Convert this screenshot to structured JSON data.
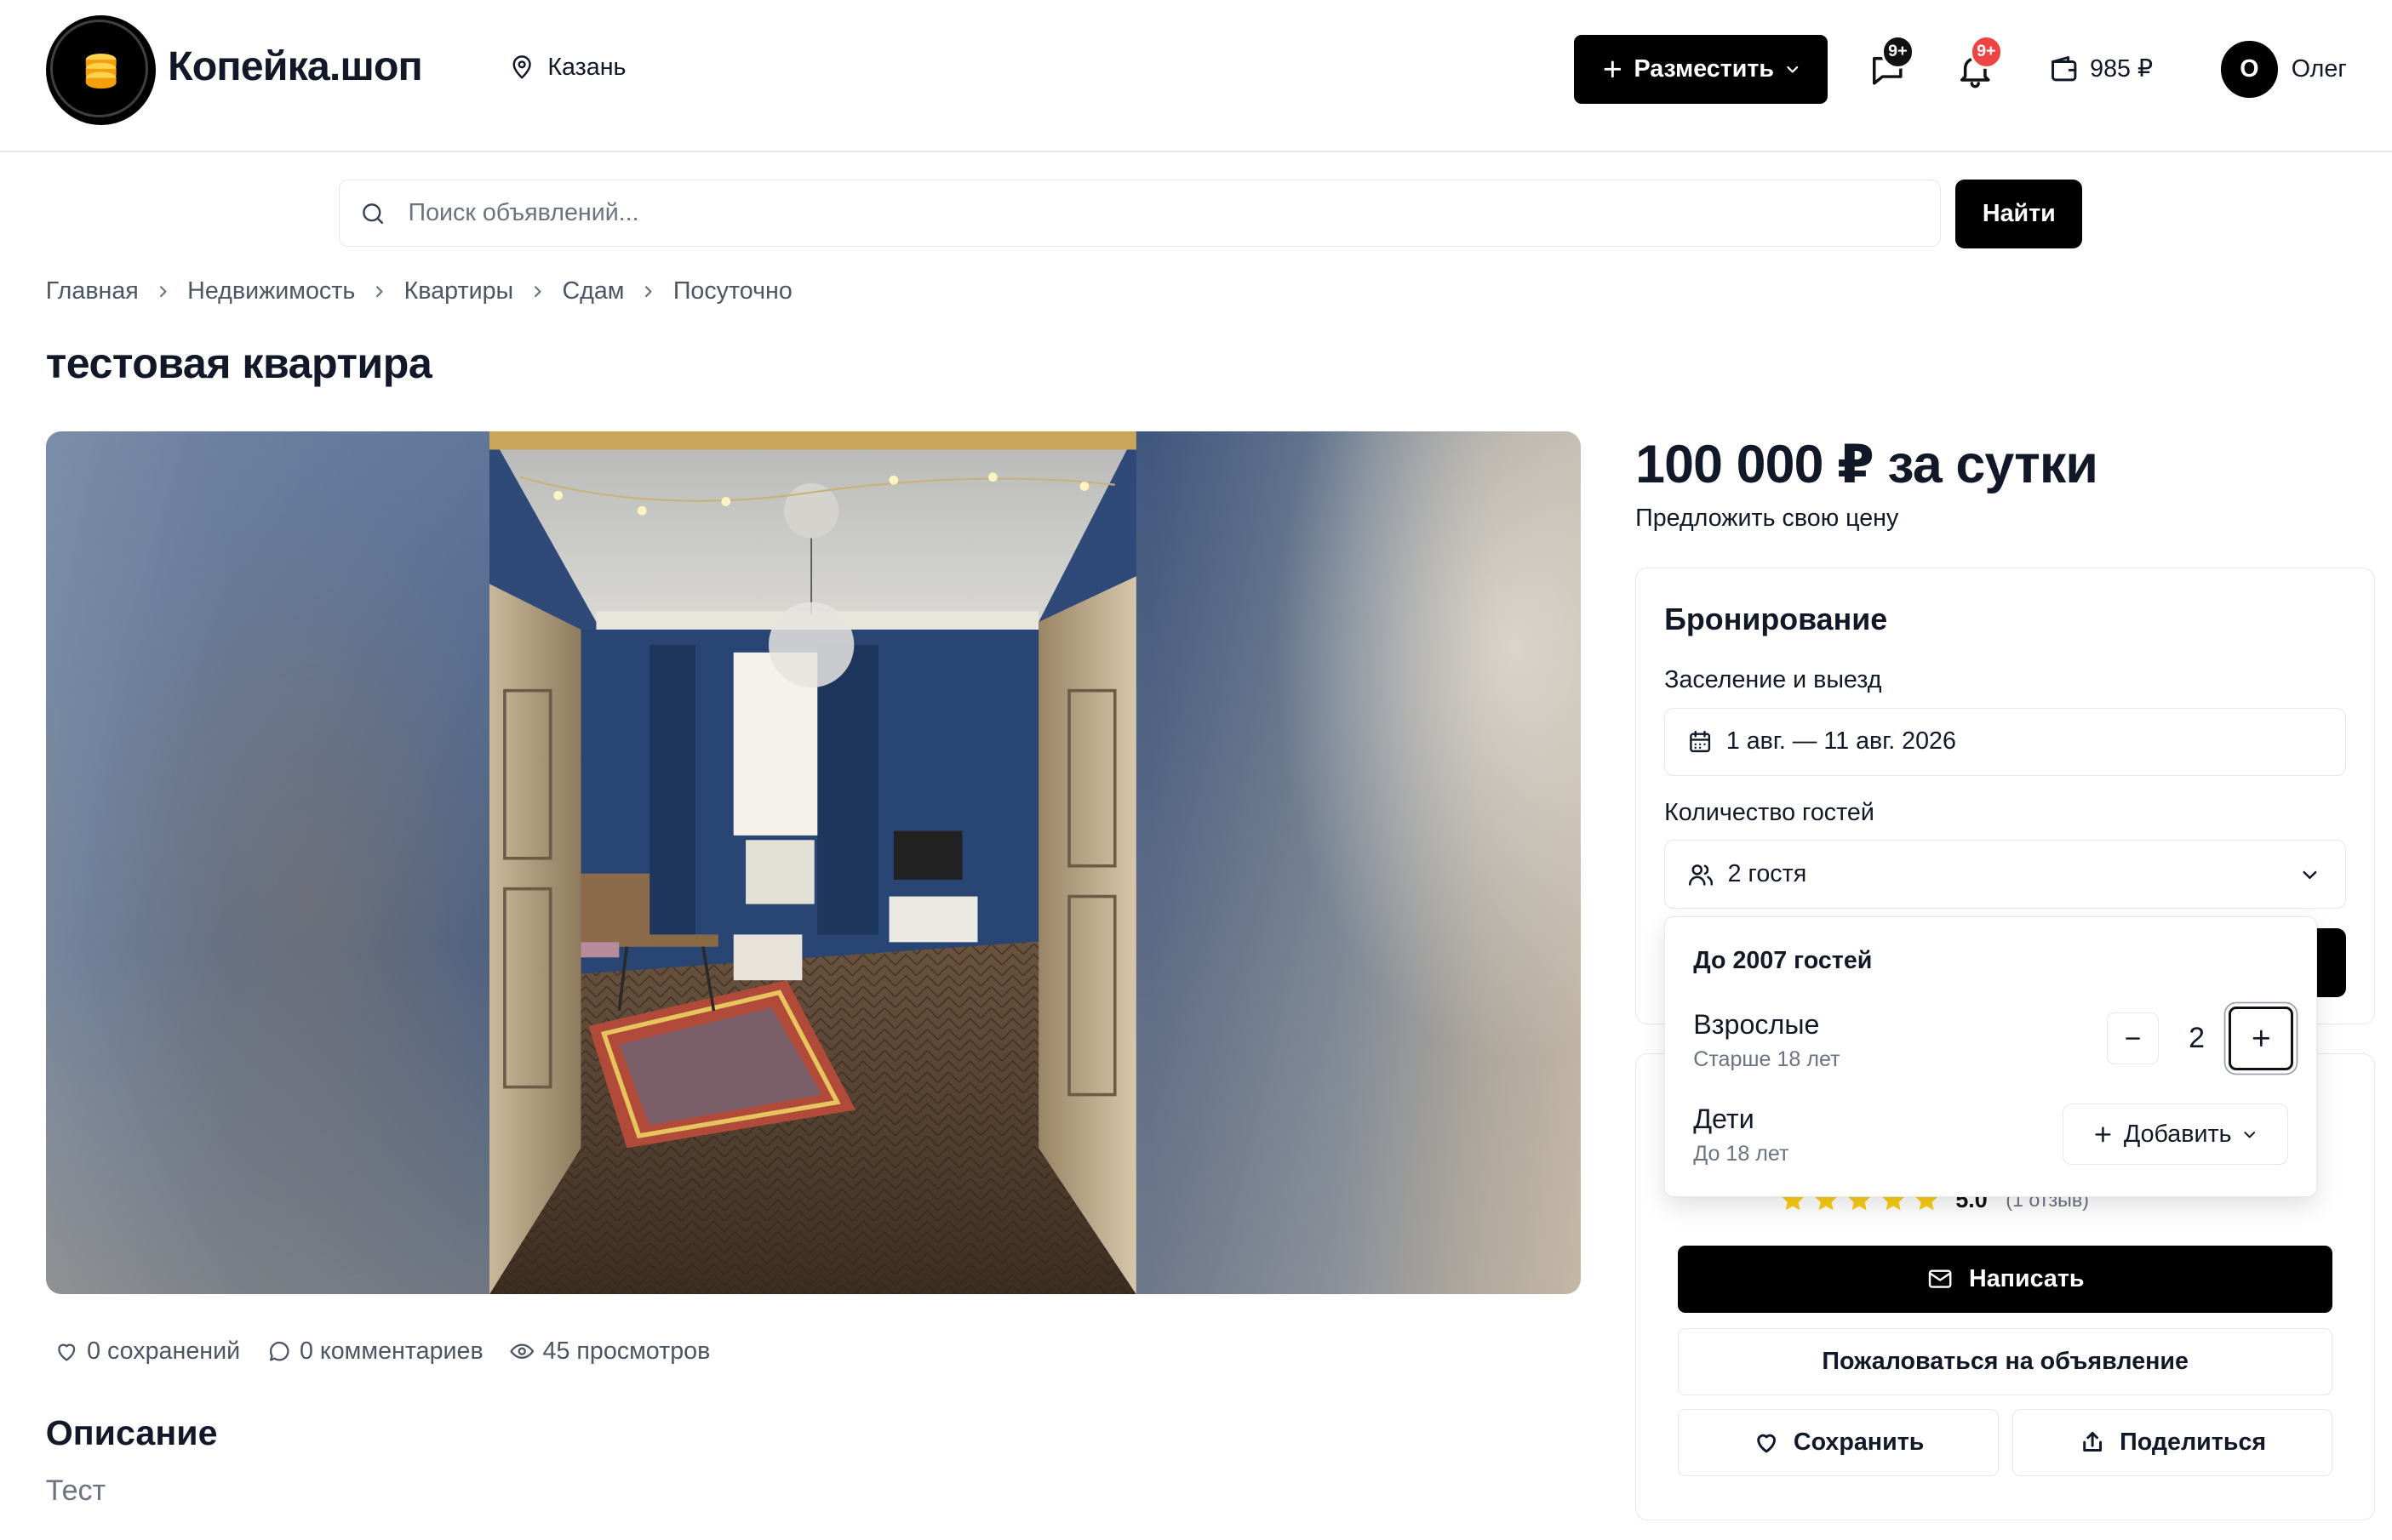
{
  "header": {
    "logo_text": "Копейка.шоп",
    "city": "Казань",
    "post_button": "Разместить",
    "messages_badge": "9+",
    "notifications_badge": "9+",
    "wallet": "985 ₽",
    "avatar_initial": "О",
    "user_name": "Олег"
  },
  "search": {
    "placeholder": "Поиск объявлений...",
    "button": "Найти"
  },
  "breadcrumb": [
    "Главная",
    "Недвижимость",
    "Квартиры",
    "Сдам",
    "Посуточно"
  ],
  "listing": {
    "title": "тестовая квартира",
    "price": "100 000 ₽ за сутки",
    "offer_link": "Предложить свою цену",
    "stats": {
      "saves": "0 сохранений",
      "comments": "0 комментариев",
      "views": "45 просмотров"
    },
    "description_title": "Описание",
    "description_text": "Тест"
  },
  "booking": {
    "title": "Бронирование",
    "dates_label": "Заселение и выезд",
    "dates_value": "1 авг. — 11 авг. 2026",
    "guests_label": "Количество гостей",
    "guests_value": "2 гостя"
  },
  "guests_popover": {
    "max": "До 2007 гостей",
    "adults_label": "Взрослые",
    "adults_sub": "Старше 18 лет",
    "adults_count": "2",
    "children_label": "Дети",
    "children_sub": "До 18 лет",
    "children_add": "Добавить"
  },
  "seller": {
    "rating": "5.0",
    "stars": 5,
    "reviews": "(1 отзыв)",
    "write_button": "Написать",
    "report_button": "Пожаловаться на объявление",
    "save_button": "Сохранить",
    "share_button": "Поделиться"
  },
  "colors": {
    "primary": "#000000",
    "badge_dark": "#111111",
    "badge_red": "#ef4444",
    "star": "#facc15",
    "muted_text": "#6b7280",
    "border": "#e5e7eb"
  }
}
